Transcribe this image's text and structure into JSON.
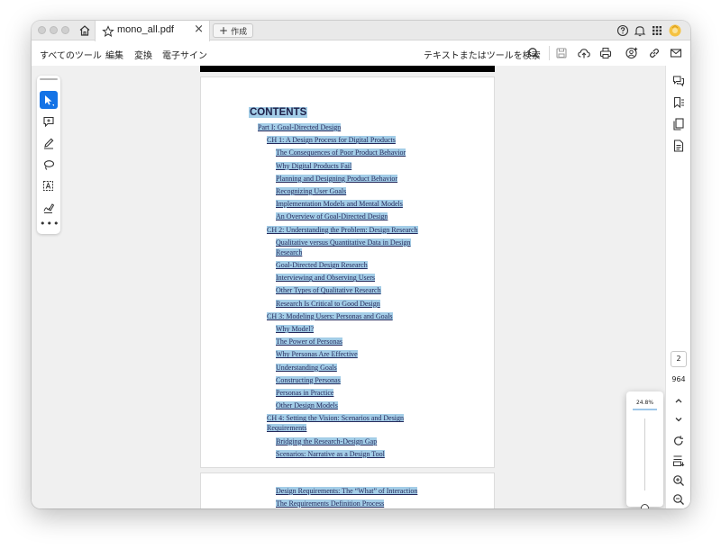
{
  "tab": {
    "title": "mono_all.pdf",
    "close": "×"
  },
  "new_tab": {
    "plus": "+",
    "label": "作成"
  },
  "menu": {
    "items": [
      "すべてのツール",
      "編集",
      "変換",
      "電子サイン"
    ],
    "search_label": "テキストまたはツールを検索"
  },
  "toc": {
    "title": "CONTENTS",
    "entries": [
      {
        "text": "Part I: Goal-Directed Design",
        "level": 0
      },
      {
        "text": "CH 1: A Design Process for Digital Products",
        "level": 1
      },
      {
        "text": "The Consequences of Poor Product Behavior",
        "level": 2
      },
      {
        "text": "Why Digital Products Fail",
        "level": 2
      },
      {
        "text": "Planning and Designing Product Behavior",
        "level": 2
      },
      {
        "text": "Recognizing User Goals",
        "level": 2
      },
      {
        "text": "Implementation Models and Mental Models",
        "level": 2
      },
      {
        "text": "An Overview of Goal-Directed Design",
        "level": 2
      },
      {
        "text": "CH 2: Understanding the Problem: Design Research",
        "level": 1
      },
      {
        "text": "Qualitative versus Quantitative Data in Design",
        "level": 2
      },
      {
        "text": "Research",
        "level": 2
      },
      {
        "text": "Goal-Directed Design Research",
        "level": 2
      },
      {
        "text": "Interviewing and Observing Users",
        "level": 2
      },
      {
        "text": "Other Types of Qualitative Research",
        "level": 2
      },
      {
        "text": "Research Is Critical to Good Design",
        "level": 2
      },
      {
        "text": "CH 3: Modeling Users: Personas and Goals",
        "level": 1
      },
      {
        "text": "Why Model?",
        "level": 2
      },
      {
        "text": "The Power of Personas",
        "level": 2
      },
      {
        "text": "Why Personas Are Effective",
        "level": 2
      },
      {
        "text": "Understanding Goals",
        "level": 2
      },
      {
        "text": "Constructing Personas",
        "level": 2
      },
      {
        "text": "Personas in Practice",
        "level": 2
      },
      {
        "text": "Other Design Models",
        "level": 2
      },
      {
        "text": "CH 4: Setting the Vision: Scenarios and Design",
        "level": 1
      },
      {
        "text": "Requirements",
        "level": 1
      },
      {
        "text": "Bridging the Research-Design Gap",
        "level": 2
      },
      {
        "text": "Scenarios: Narrative as a Design Tool",
        "level": 2
      }
    ],
    "page2_entries": [
      {
        "text": "Design Requirements: The “What” of Interaction",
        "level": 2
      },
      {
        "text": "The Requirements Definition Process",
        "level": 2
      }
    ]
  },
  "page_nav": {
    "current": "2",
    "total": "964"
  },
  "zoom": {
    "value": "24.8%",
    "level_fraction": 0.02
  },
  "left_tools": [
    "select-tool",
    "comment-tool",
    "draw-tool",
    "lasso-tool",
    "text-select-tool",
    "sign-tool",
    "more-tools"
  ],
  "colors": {
    "accent": "#1473e6",
    "highlight": "#a3cde7",
    "link_text": "#262a5c",
    "profile": "#f5c242"
  }
}
